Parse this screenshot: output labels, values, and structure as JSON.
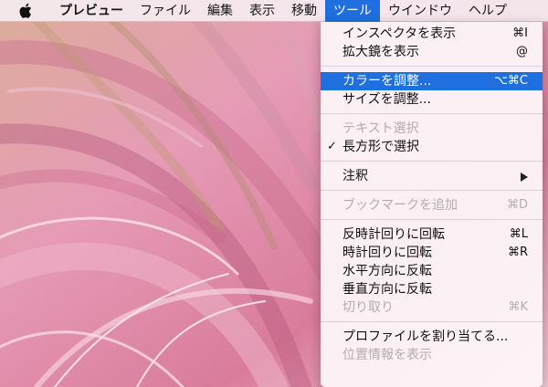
{
  "menubar": {
    "items": [
      {
        "label": "プレビュー"
      },
      {
        "label": "ファイル"
      },
      {
        "label": "編集"
      },
      {
        "label": "表示"
      },
      {
        "label": "移動"
      },
      {
        "label": "ツール"
      },
      {
        "label": "ウインドウ"
      },
      {
        "label": "ヘルプ"
      }
    ]
  },
  "menu": {
    "groups": [
      [
        {
          "label": "インスペクタを表示",
          "shortcut": "⌘I"
        },
        {
          "label": "拡大鏡を表示",
          "shortcut": "@"
        }
      ],
      [
        {
          "label": "カラーを調整...",
          "shortcut": "⌥⌘C"
        },
        {
          "label": "サイズを調整...",
          "shortcut": ""
        }
      ],
      [
        {
          "label": "テキスト選択",
          "shortcut": ""
        },
        {
          "label": "長方形で選択",
          "shortcut": "",
          "check": "✓"
        }
      ],
      [
        {
          "label": "注釈",
          "shortcut": ""
        }
      ],
      [
        {
          "label": "ブックマークを追加",
          "shortcut": "⌘D"
        }
      ],
      [
        {
          "label": "反時計回りに回転",
          "shortcut": "⌘L"
        },
        {
          "label": "時計回りに回転",
          "shortcut": "⌘R"
        },
        {
          "label": "水平方向に反転",
          "shortcut": ""
        },
        {
          "label": "垂直方向に反転",
          "shortcut": ""
        },
        {
          "label": "切り取り",
          "shortcut": "⌘K"
        }
      ],
      [
        {
          "label": "プロファイルを割り当てる...",
          "shortcut": ""
        },
        {
          "label": "位置情報を表示",
          "shortcut": ""
        }
      ]
    ]
  },
  "colors": {
    "highlight": "#1f6fe0",
    "disabled_text": "#b3adb0",
    "background": "#e9a9bd"
  },
  "icons": {
    "apple": "apple-logo-icon",
    "submenu": "submenu-arrow-icon",
    "check": "checkmark-icon"
  }
}
